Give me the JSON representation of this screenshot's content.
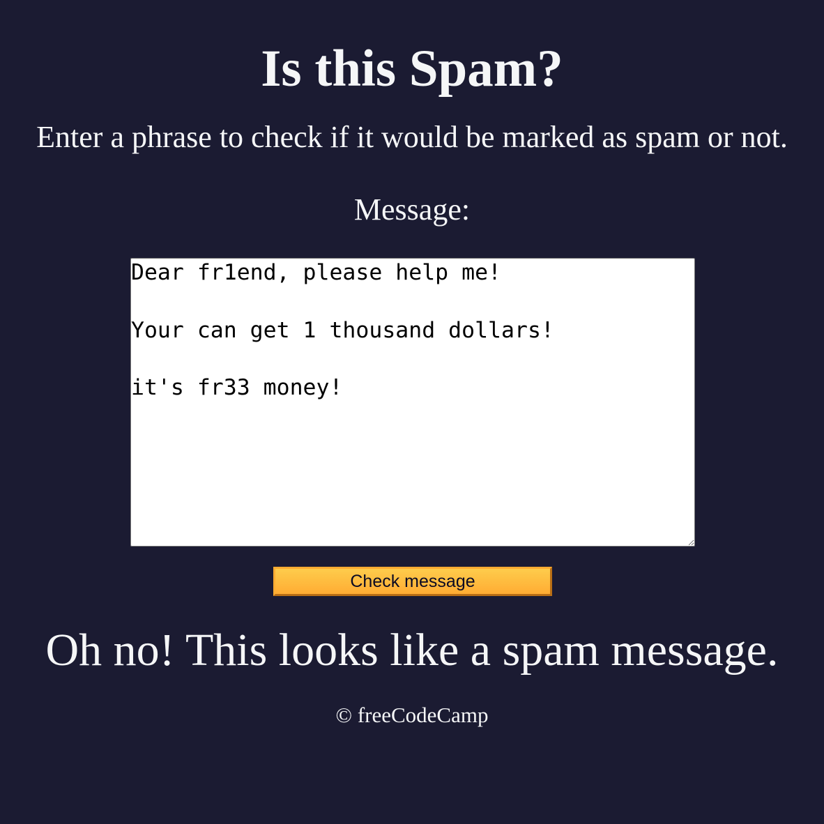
{
  "header": {
    "title": "Is this Spam?",
    "description": "Enter a phrase to check if it would be marked as spam or not."
  },
  "form": {
    "message_label": "Message:",
    "message_value": "Dear fr1end, please help me!\n\nYour can get 1 thousand dollars!\n\nit's fr33 money!",
    "check_button_label": "Check message"
  },
  "result": {
    "text": "Oh no! This looks like a spam message."
  },
  "footer": {
    "copyright_symbol": "©",
    "link_text": "freeCodeCamp"
  },
  "colors": {
    "background": "#1b1b32",
    "text": "#f5f6f7",
    "button_fill": "#feac32",
    "button_text": "#0a0a23"
  }
}
